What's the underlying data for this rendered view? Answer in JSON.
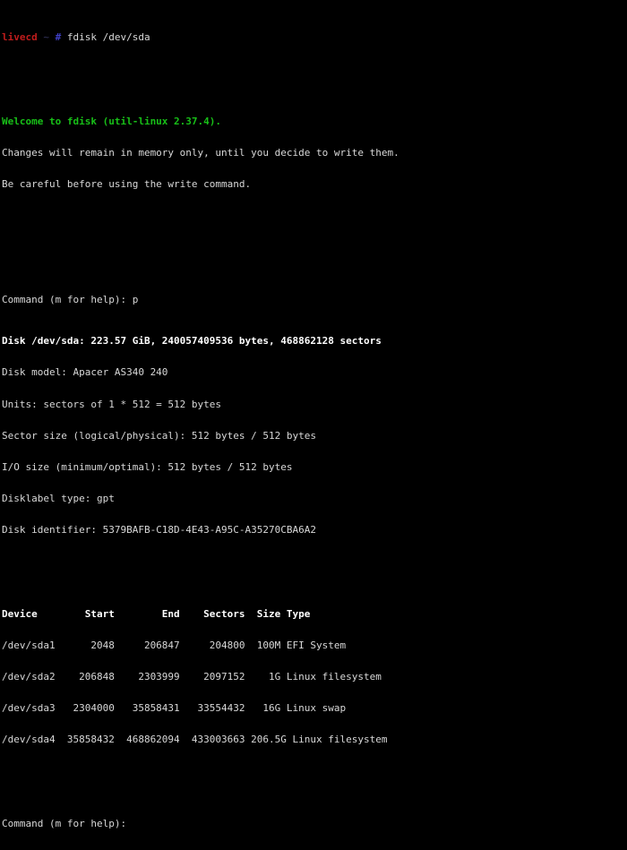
{
  "terminal": {
    "shell_prompt": {
      "host": "livecd",
      "separator": " ~ ",
      "symbol": "#",
      "command": " fdisk /dev/sda"
    },
    "welcome_line": "Welcome to fdisk (util-linux 2.37.4).",
    "notice_lines": [
      "Changes will remain in memory only, until you decide to write them.",
      "Be careful before using the write command."
    ],
    "command_echo": "Command (m for help): p",
    "disk_info": [
      "Disk /dev/sda: 223.57 GiB, 240057409536 bytes, 468862128 sectors",
      "Disk model: Apacer AS340 240",
      "Units: sectors of 1 * 512 = 512 bytes",
      "Sector size (logical/physical): 512 bytes / 512 bytes",
      "I/O size (minimum/optimal): 512 bytes / 512 bytes",
      "Disklabel type: gpt",
      "Disk identifier: 5379BAFB-C18D-4E43-A95C-A35270CBA6A2"
    ],
    "disk_info_bold": [
      true,
      false,
      false,
      false,
      false,
      false,
      false
    ],
    "partition_table": {
      "header": "Device        Start        End    Sectors  Size Type",
      "rows": [
        "/dev/sda1      2048     206847     204800  100M EFI System",
        "/dev/sda2    206848    2303999    2097152    1G Linux filesystem",
        "/dev/sda3   2304000   35858431   33554432   16G Linux swap",
        "/dev/sda4  35858432  468862094  433003663 206.5G Linux filesystem"
      ]
    },
    "final_prompt": "Command (m for help): ",
    "colors": {
      "background": "#000000",
      "foreground": "#d8d8d8",
      "host": "#c01c1c",
      "symbol": "#4040c8",
      "welcome": "#18c018",
      "bright": "#ffffff"
    }
  }
}
